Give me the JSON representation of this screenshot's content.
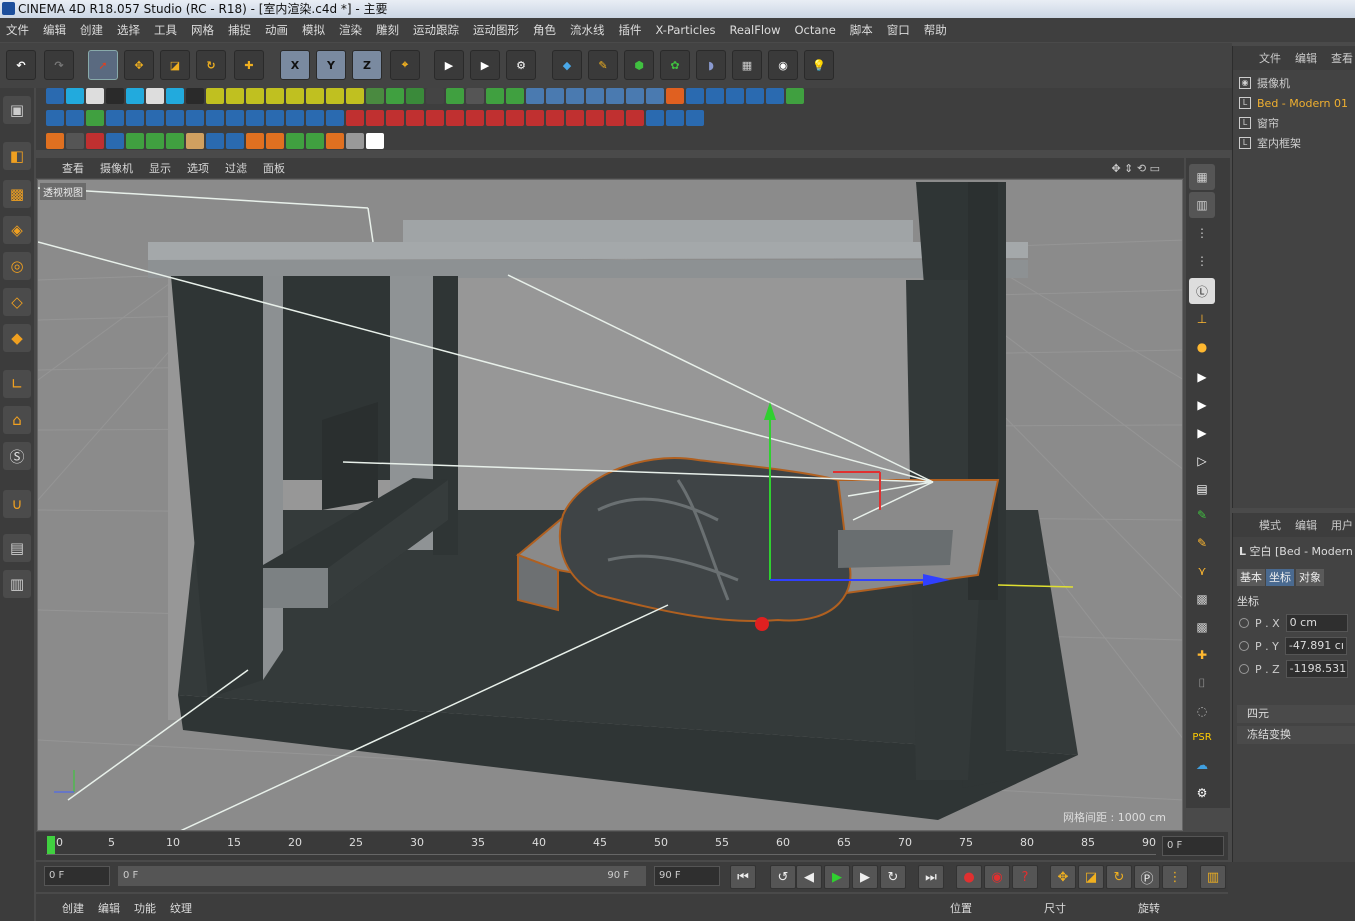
{
  "window": {
    "title": "CINEMA 4D R18.057 Studio (RC - R18) - [室内渲染.c4d *] - 主要"
  },
  "menu": [
    "文件",
    "编辑",
    "创建",
    "选择",
    "工具",
    "网格",
    "捕捉",
    "动画",
    "模拟",
    "渲染",
    "雕刻",
    "运动跟踪",
    "运动图形",
    "角色",
    "流水线",
    "插件",
    "X-Particles",
    "RealFlow",
    "Octane",
    "脚本",
    "窗口",
    "帮助"
  ],
  "toolbar": {
    "axis_labels": [
      "X",
      "Y",
      "Z"
    ]
  },
  "viewport": {
    "menu": [
      "查看",
      "摄像机",
      "显示",
      "选项",
      "过滤",
      "面板"
    ],
    "label": "透视视图",
    "grid_spacing": "网格间距 : 1000 cm"
  },
  "object_manager": {
    "menu": [
      "文件",
      "编辑",
      "查看"
    ],
    "objects": [
      {
        "name": "摄像机",
        "color": "#cfcfcf"
      },
      {
        "name": "Bed - Modern 01",
        "color": "#f0b030"
      },
      {
        "name": "窗帘",
        "color": "#cfcfcf"
      },
      {
        "name": "室内框架",
        "color": "#cfcfcf"
      }
    ]
  },
  "attribute_manager": {
    "menu": [
      "模式",
      "编辑",
      "用户"
    ],
    "object_title": "空白 [Bed - Modern",
    "tabs": [
      "基本",
      "坐标",
      "对象"
    ],
    "section": "坐标",
    "coords": [
      {
        "label": "P . X",
        "value": "0 cm"
      },
      {
        "label": "P . Y",
        "value": "-47.891 cı"
      },
      {
        "label": "P . Z",
        "value": "-1198.531"
      }
    ],
    "collapsed": [
      "四元",
      "冻结变换"
    ]
  },
  "timeline": {
    "ticks": [
      "0",
      "5",
      "10",
      "15",
      "20",
      "25",
      "30",
      "35",
      "40",
      "45",
      "50",
      "55",
      "60",
      "65",
      "70",
      "75",
      "80",
      "85",
      "90"
    ],
    "current": "0 F"
  },
  "playback": {
    "start": "0 F",
    "range_start": "0 F",
    "range_end": "90 F",
    "end": "90 F"
  },
  "material_bar": {
    "menu": [
      "创建",
      "编辑",
      "功能",
      "纹理"
    ]
  },
  "coord_bar": {
    "labels": [
      "位置",
      "尺寸",
      "旋转"
    ]
  }
}
